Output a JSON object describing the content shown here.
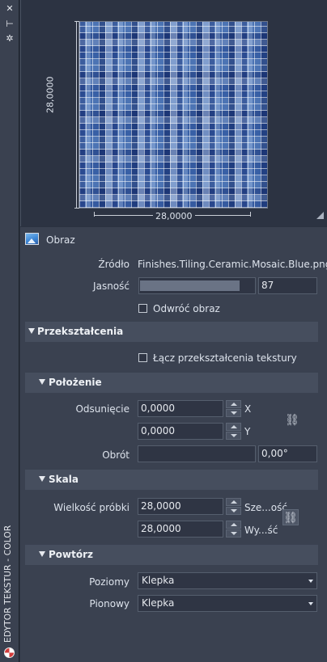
{
  "panel": {
    "vertical_title": "EDYTOR TEKSTUR - COLOR"
  },
  "preview": {
    "height_label": "28,0000",
    "width_label": "28,0000"
  },
  "image": {
    "section_label": "Obraz",
    "source_label": "Źródło",
    "source_value": "Finishes.Tiling.Ceramic.Mosaic.Blue.png",
    "brightness_label": "Jasność",
    "brightness_value": "87",
    "brightness_level": 0.87,
    "invert_label": "Odwróć obraz",
    "invert_checked": false
  },
  "transforms": {
    "title": "Przekształcenia",
    "link_label": "Łącz przekształcenia tekstury",
    "link_checked": false
  },
  "position": {
    "title": "Położenie",
    "offset_label": "Odsunięcie",
    "offset_x": "0,0000",
    "offset_y": "0,0000",
    "x_axis": "X",
    "y_axis": "Y",
    "rotation_label": "Obrót",
    "rotation_value": "0,00°"
  },
  "scale": {
    "title": "Skala",
    "sample_size_label": "Wielkość próbki",
    "width_value": "28,0000",
    "width_unit": "Sze...ość",
    "height_value": "28,0000",
    "height_unit": "Wy...ść"
  },
  "repeat": {
    "title": "Powtórz",
    "horizontal_label": "Poziomy",
    "horizontal_value": "Klepka",
    "vertical_label": "Pionowy",
    "vertical_value": "Klepka"
  }
}
